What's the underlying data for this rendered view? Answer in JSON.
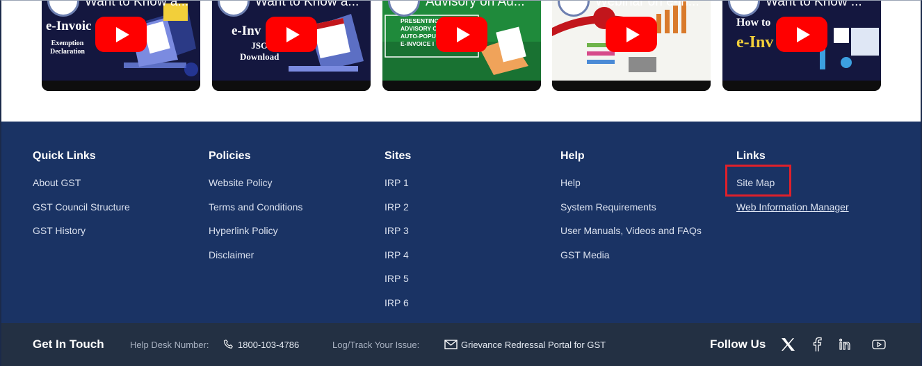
{
  "videos": [
    {
      "title": "Want to Know a...",
      "big_text": "e-Invoic",
      "small_text": "Exemption\nDeclaration",
      "bg": "#14173f",
      "accent": "#2b3a86"
    },
    {
      "title": "Want to Know a...",
      "big_text": "e-Inv",
      "small_text": "JSO\nDownload",
      "bg": "#14173f",
      "accent": "#2b3a86"
    },
    {
      "title": "Advisory on Au...",
      "big_text": "",
      "small_text": "PRESENTING\nADVISORY O\nAUTO-POPUL\nE-INVOICE I",
      "bg": "#1f8a3b",
      "accent": "#f0a35a"
    },
    {
      "title": "Webinar on e-in...",
      "big_text": "",
      "small_text": "",
      "bg": "#f4f4f0",
      "accent": "#c2161c"
    },
    {
      "title": "Want to Know ...",
      "big_text": "e-Inv",
      "small_text": "How to",
      "bg": "#14173f",
      "accent": "#2b3a86"
    }
  ],
  "footer": {
    "columns": [
      {
        "heading": "Quick Links",
        "links": [
          "About GST",
          "GST Council Structure",
          "GST History"
        ]
      },
      {
        "heading": "Policies",
        "links": [
          "Website Policy",
          "Terms and Conditions",
          "Hyperlink Policy",
          "Disclaimer"
        ]
      },
      {
        "heading": "Sites",
        "links": [
          "IRP 1",
          "IRP 2",
          "IRP 3",
          "IRP 4",
          "IRP 5",
          "IRP 6"
        ]
      },
      {
        "heading": "Help",
        "links": [
          "Help",
          "System Requirements",
          "User Manuals, Videos and FAQs",
          "GST Media"
        ]
      },
      {
        "heading": "Links",
        "links": [
          "Site Map",
          "Web Information Manager"
        ]
      }
    ],
    "bottom": {
      "get_in_touch": "Get In Touch",
      "helpdesk_label": "Help Desk Number:",
      "helpdesk_number": "1800-103-4786",
      "log_label": "Log/Track Your Issue:",
      "grievance_link": "Grievance Redressal Portal for GST",
      "follow_us": "Follow Us",
      "social_icons": [
        "x-icon",
        "facebook-icon",
        "linkedin-icon",
        "youtube-icon"
      ]
    }
  },
  "colors": {
    "footer_bg": "#1a3364",
    "footer_bottom_bg": "#233043",
    "highlight": "#e0202a",
    "play_button": "#ff0000"
  }
}
